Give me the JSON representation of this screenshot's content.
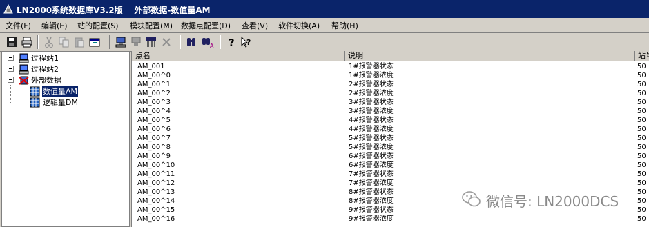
{
  "window": {
    "title": "LN2000系统数据库V3.2版    外部数据-数值量AM"
  },
  "menu": [
    {
      "label": "文件(F)"
    },
    {
      "label": "编辑(E)"
    },
    {
      "label": "站的配置(S)"
    },
    {
      "label": "模块配置(M)"
    },
    {
      "label": "数据点配置(D)"
    },
    {
      "label": "查看(V)"
    },
    {
      "label": "软件切换(A)"
    },
    {
      "label": "帮助(H)"
    }
  ],
  "toolbar": {
    "icons": [
      "save-icon",
      "print-icon",
      "cut-icon",
      "copy-icon",
      "paste-icon",
      "properties-icon",
      "add-station-icon",
      "delete-station-icon",
      "add-module-icon",
      "delete-icon",
      "find-icon",
      "replace-icon",
      "help-icon",
      "context-help-icon"
    ]
  },
  "tree": {
    "nodes": [
      {
        "label": "过程站1",
        "icon": "station-icon"
      },
      {
        "label": "过程站2",
        "icon": "station-icon"
      },
      {
        "label": "外部数据",
        "icon": "external-data-icon"
      },
      {
        "label": "数值量AM",
        "icon": "table-icon",
        "selected": true
      },
      {
        "label": "逻辑量DM",
        "icon": "table-icon"
      }
    ]
  },
  "grid": {
    "columns": [
      "点名",
      "说明",
      "站号"
    ],
    "rows": [
      {
        "name": "AM_001",
        "desc": "1#报警器状态",
        "station": "50"
      },
      {
        "name": "AM_00^0",
        "desc": "1#报警器浓度",
        "station": "50"
      },
      {
        "name": "AM_00^1",
        "desc": "2#报警器状态",
        "station": "50"
      },
      {
        "name": "AM_00^2",
        "desc": "2#报警器浓度",
        "station": "50"
      },
      {
        "name": "AM_00^3",
        "desc": "3#报警器状态",
        "station": "50"
      },
      {
        "name": "AM_00^4",
        "desc": "3#报警器浓度",
        "station": "50"
      },
      {
        "name": "AM_00^5",
        "desc": "4#报警器状态",
        "station": "50"
      },
      {
        "name": "AM_00^6",
        "desc": "4#报警器浓度",
        "station": "50"
      },
      {
        "name": "AM_00^7",
        "desc": "5#报警器状态",
        "station": "50"
      },
      {
        "name": "AM_00^8",
        "desc": "5#报警器浓度",
        "station": "50"
      },
      {
        "name": "AM_00^9",
        "desc": "6#报警器状态",
        "station": "50"
      },
      {
        "name": "AM_00^10",
        "desc": "6#报警器浓度",
        "station": "50"
      },
      {
        "name": "AM_00^11",
        "desc": "7#报警器状态",
        "station": "50"
      },
      {
        "name": "AM_00^12",
        "desc": "7#报警器浓度",
        "station": "50"
      },
      {
        "name": "AM_00^13",
        "desc": "8#报警器状态",
        "station": "50"
      },
      {
        "name": "AM_00^14",
        "desc": "8#报警器浓度",
        "station": "50"
      },
      {
        "name": "AM_00^15",
        "desc": "9#报警器状态",
        "station": "50"
      },
      {
        "name": "AM_00^16",
        "desc": "9#报警器浓度",
        "station": "50"
      }
    ]
  },
  "watermark": {
    "text": "微信号: LN2000DCS"
  }
}
